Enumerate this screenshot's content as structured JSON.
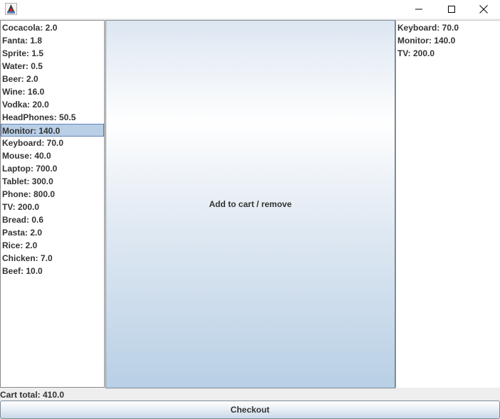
{
  "window": {
    "app_icon": "java-duke-icon",
    "controls": [
      "minimize-icon",
      "maximize-icon",
      "close-icon"
    ]
  },
  "products": [
    "Cocacola: 2.0",
    "Fanta: 1.8",
    "Sprite: 1.5",
    "Water: 0.5",
    "Beer: 2.0",
    "Wine: 16.0",
    "Vodka: 20.0",
    "HeadPhones: 50.5",
    "Monitor: 140.0",
    "Keyboard: 70.0",
    "Mouse: 40.0",
    "Laptop: 700.0",
    "Tablet: 300.0",
    "Phone: 800.0",
    "TV: 200.0",
    "Bread: 0.6",
    "Pasta: 2.0",
    "Rice: 2.0",
    "Chicken: 7.0",
    "Beef: 10.0"
  ],
  "selected_product": "Monitor: 140.0",
  "cart": [
    "Keyboard: 70.0",
    "Monitor: 140.0",
    "TV: 200.0"
  ],
  "add_remove_label": "Add to cart / remove",
  "cart_total_label": "Cart total: 410.0",
  "checkout_label": "Checkout",
  "colors": {
    "selection_bg": "#b8cfe5",
    "selection_border": "#6382bf"
  }
}
